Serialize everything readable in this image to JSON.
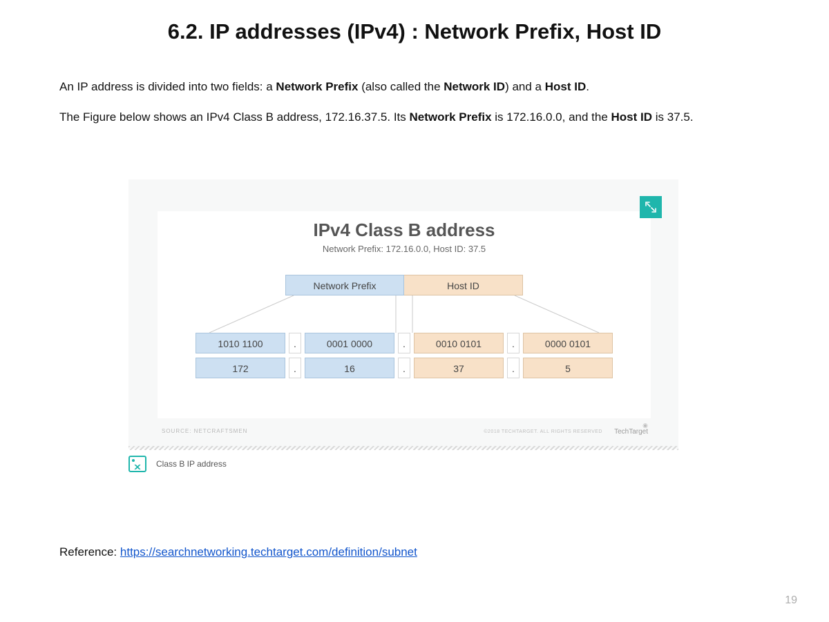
{
  "title": "6.2. IP addresses (IPv4) : Network Prefix, Host ID",
  "intro": {
    "p1_pre": "An IP address is divided into two fields: a ",
    "p1_b1": "Network Prefix",
    "p1_mid1": " (also called the ",
    "p1_b2": "Network ID",
    "p1_mid2": ") and a ",
    "p1_b3": "Host ID",
    "p1_post": ".",
    "p2_pre": "The Figure below shows an IPv4 Class B address, 172.16.37.5. Its ",
    "p2_b1": "Network Prefix",
    "p2_mid1": " is 172.16.0.0, and the ",
    "p2_b2": "Host ID",
    "p2_post": " is 37.5."
  },
  "diagram": {
    "title": "IPv4 Class B address",
    "subtitle": "Network Prefix: 172.16.0.0, Host ID: 37.5",
    "section_prefix": "Network Prefix",
    "section_host": "Host ID",
    "dot": ".",
    "bin": {
      "o1": "1010 1100",
      "o2": "0001 0000",
      "o3": "0010 0101",
      "o4": "0000 0101"
    },
    "dec": {
      "o1": "172",
      "o2": "16",
      "o3": "37",
      "o4": "5"
    },
    "source_label": "SOURCE: NETCRAFTSMEN",
    "copyright": "©2018 TECHTARGET. ALL RIGHTS RESERVED",
    "brand": "TechTarget"
  },
  "caption": "Class B IP address",
  "reference_label": "Reference: ",
  "reference_url": "https://searchnetworking.techtarget.com/definition/subnet",
  "page_number": "19"
}
